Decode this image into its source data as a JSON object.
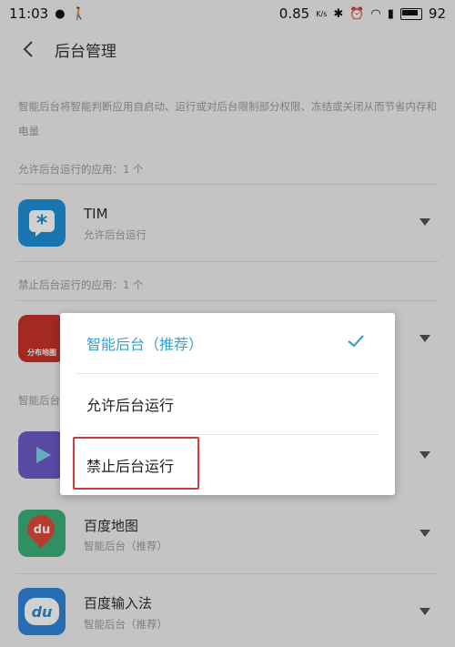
{
  "status_bar": {
    "time": "11:03",
    "speed": "0.85",
    "speed_unit": "K/s",
    "battery": "92"
  },
  "header": {
    "title": "后台管理"
  },
  "description": "智能后台将智能判断应用自启动、运行或对后台限制部分权限、冻结或关闭从而节省内存和电量",
  "sections": {
    "allowed": "允许后台运行的应用：1 个",
    "forbidden": "禁止后台运行的应用：1 个",
    "smart": "智能后台"
  },
  "apps": [
    {
      "name": "TIM",
      "status": "允许后台运行",
      "icon": "tim-icon",
      "color": "#1e8fd6"
    },
    {
      "name": "",
      "status": "",
      "icon": "map-share-icon",
      "color": "#c8322a",
      "icon_text": "分布地图"
    },
    {
      "name": "",
      "status": "",
      "icon": "video-app-icon",
      "color": "#6b5cc8"
    },
    {
      "name": "百度地图",
      "status": "智能后台（推荐）",
      "icon": "baidu-map-icon",
      "color": "#3bb07a",
      "icon_text": "du"
    },
    {
      "name": "百度输入法",
      "status": "智能后台（推荐）",
      "icon": "baidu-input-icon",
      "color": "#2f86d9",
      "icon_text": "du"
    }
  ],
  "menu": {
    "options": [
      {
        "label": "智能后台（推荐）",
        "selected": true
      },
      {
        "label": "允许后台运行",
        "selected": false
      },
      {
        "label": "禁止后台运行",
        "selected": false
      }
    ]
  },
  "colors": {
    "accent": "#3aa0c8",
    "highlight_border": "#d23b3b"
  }
}
